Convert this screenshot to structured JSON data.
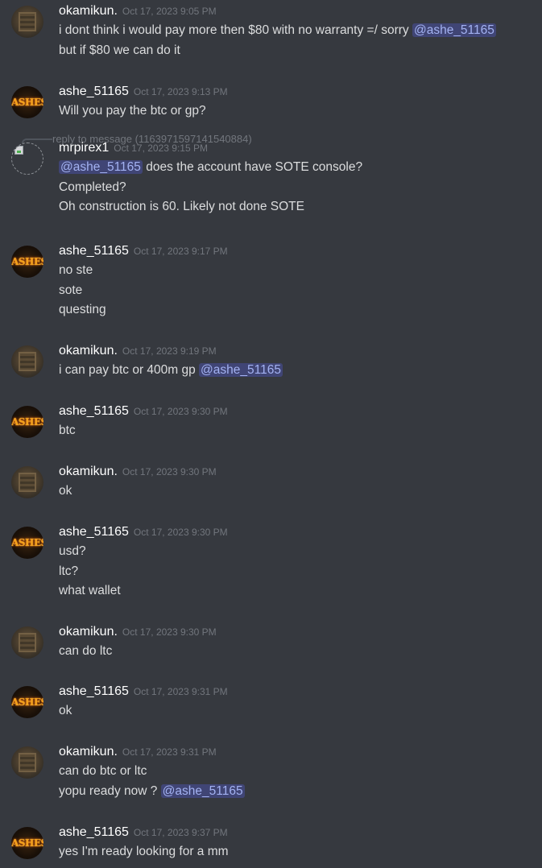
{
  "mention_text": "@ashe_51165",
  "messages": [
    {
      "author": "okamikun.",
      "timestamp": "Oct 17, 2023 9:05 PM",
      "avatar": "okamikun-avatar",
      "lines": [
        {
          "text": "i dont think i would pay more then $80 with no warranty =/ sorry ",
          "mention": "@ashe_51165"
        },
        {
          "text": "but if $80 we can do it"
        }
      ]
    },
    {
      "author": "ashe_51165",
      "timestamp": "Oct 17, 2023 9:13 PM",
      "avatar": "ashes-avatar",
      "avatar_text": "ASHES",
      "lines": [
        {
          "text": "Will you pay the btc or gp?"
        }
      ]
    },
    {
      "author": "mrpirex1",
      "timestamp": "Oct 17, 2023 9:15 PM",
      "avatar": "broken-image-avatar",
      "reply_to": "reply to message (1163971597141540884)",
      "lines": [
        {
          "mention_first": "@ashe_51165",
          "text": " does the account have SOTE console?"
        },
        {
          "text": "Completed?"
        },
        {
          "text": "Oh construction is 60. Likely not done SOTE"
        }
      ]
    },
    {
      "author": "ashe_51165",
      "timestamp": "Oct 17, 2023 9:17 PM",
      "avatar": "ashes-avatar",
      "avatar_text": "ASHES",
      "lines": [
        {
          "text": "no ste"
        },
        {
          "text": "sote"
        },
        {
          "text": "questing"
        }
      ]
    },
    {
      "author": "okamikun.",
      "timestamp": "Oct 17, 2023 9:19 PM",
      "avatar": "okamikun-avatar",
      "lines": [
        {
          "text": "i can pay btc or 400m gp ",
          "mention": "@ashe_51165"
        }
      ]
    },
    {
      "author": "ashe_51165",
      "timestamp": "Oct 17, 2023 9:30 PM",
      "avatar": "ashes-avatar",
      "avatar_text": "ASHES",
      "lines": [
        {
          "text": "btc"
        }
      ]
    },
    {
      "author": "okamikun.",
      "timestamp": "Oct 17, 2023 9:30 PM",
      "avatar": "okamikun-avatar",
      "lines": [
        {
          "text": "ok"
        }
      ]
    },
    {
      "author": "ashe_51165",
      "timestamp": "Oct 17, 2023 9:30 PM",
      "avatar": "ashes-avatar",
      "avatar_text": "ASHES",
      "lines": [
        {
          "text": "usd?"
        },
        {
          "text": "ltc?"
        },
        {
          "text": "what wallet"
        }
      ]
    },
    {
      "author": "okamikun.",
      "timestamp": "Oct 17, 2023 9:30 PM",
      "avatar": "okamikun-avatar",
      "lines": [
        {
          "text": "can do ltc"
        }
      ]
    },
    {
      "author": "ashe_51165",
      "timestamp": "Oct 17, 2023 9:31 PM",
      "avatar": "ashes-avatar",
      "avatar_text": "ASHES",
      "lines": [
        {
          "text": "ok"
        }
      ]
    },
    {
      "author": "okamikun.",
      "timestamp": "Oct 17, 2023 9:31 PM",
      "avatar": "okamikun-avatar",
      "lines": [
        {
          "text": "can do btc or ltc"
        },
        {
          "text": "yopu ready now ? ",
          "mention": "@ashe_51165"
        }
      ]
    },
    {
      "author": "ashe_51165",
      "timestamp": "Oct 17, 2023 9:37 PM",
      "avatar": "ashes-avatar",
      "avatar_text": "ASHES",
      "lines": [
        {
          "text": "yes I'm ready looking for a mm"
        }
      ]
    }
  ],
  "colors": {
    "background": "#36393f",
    "username": "#ffffff",
    "timestamp": "#72767d",
    "message_text": "#dcddde",
    "mention_text": "#a3b2f2",
    "mention_bg": "#5865f2"
  }
}
